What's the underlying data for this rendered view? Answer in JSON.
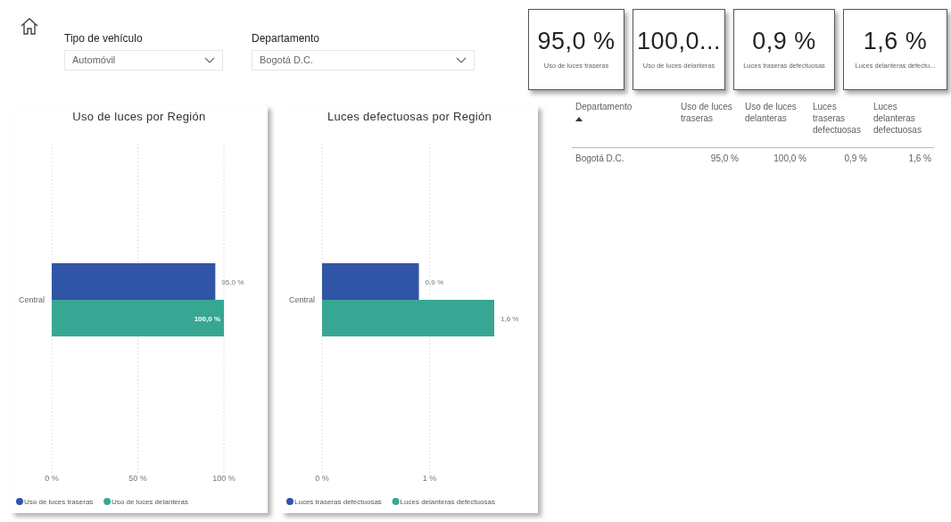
{
  "filters": [
    {
      "label": "Tipo de vehículo",
      "value": "Automóvil"
    },
    {
      "label": "Departamento",
      "value": "Bogotá D.C."
    }
  ],
  "kpi_cards": [
    {
      "value": "95,0 %",
      "label": "Uso de luces traseras"
    },
    {
      "value": "100,0...",
      "label": "Uso de luces delanteras"
    },
    {
      "value": "0,9 %",
      "label": "Luces traseras defectuosas"
    },
    {
      "value": "1,6 %",
      "label": "Luces delanteras defectu..."
    }
  ],
  "charts": [
    {
      "chart_data": {
        "type": "bar",
        "orientation": "horizontal",
        "title": "Uso de luces por Región",
        "categories": [
          "Central"
        ],
        "series": [
          {
            "name": "Uso de luces traseras",
            "color": "#3155a6",
            "values": [
              95.0
            ]
          },
          {
            "name": "Uso de luces delanteras",
            "color": "#37a794",
            "values": [
              100.0
            ]
          }
        ],
        "legend": true,
        "xlim": [
          0,
          100
        ],
        "xticks": [
          {
            "value": 0,
            "label": "0 %"
          },
          {
            "value": 50,
            "label": "50 %"
          },
          {
            "value": 100,
            "label": "100 %"
          }
        ],
        "value_labels": [
          [
            "95,0 %"
          ],
          [
            "100,0 %"
          ]
        ]
      }
    },
    {
      "chart_data": {
        "type": "bar",
        "orientation": "horizontal",
        "title": "Luces defectuosas por Región",
        "categories": [
          "Central"
        ],
        "series": [
          {
            "name": "Luces traseras defectuosas",
            "color": "#3155a6",
            "values": [
              0.9
            ]
          },
          {
            "name": "Luces delanteras defectuosas",
            "color": "#37a794",
            "values": [
              1.6
            ]
          }
        ],
        "legend": true,
        "xlim": [
          0,
          1.6
        ],
        "xticks": [
          {
            "value": 0,
            "label": "0 %"
          },
          {
            "value": 1,
            "label": "1 %"
          }
        ],
        "value_labels": [
          [
            "0,9 %"
          ],
          [
            "1,6 %"
          ]
        ]
      }
    }
  ],
  "table": {
    "columns": [
      {
        "label": "Departamento",
        "sorted": true
      },
      {
        "label": "Uso de luces traseras",
        "sorted": false
      },
      {
        "label": "Uso de luces delanteras",
        "sorted": false
      },
      {
        "label": "Luces traseras defectuosas",
        "sorted": false
      },
      {
        "label": "Luces delanteras defectuosas",
        "sorted": false
      }
    ],
    "rows": [
      [
        "Bogotá D.C.",
        "95,0 %",
        "100,0 %",
        "0,9 %",
        "1,6 %"
      ]
    ]
  }
}
